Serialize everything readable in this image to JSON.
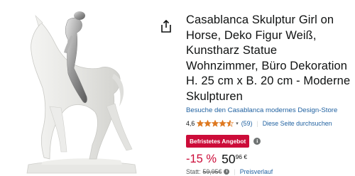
{
  "product": {
    "image_alt": "Casablanca Skulptur Girl on Horse",
    "title": "Casablanca Skulptur Girl on Horse, Deko Figur Weiß, Kunstharz Statue Wohnzimmer, Büro Dekoration H. 25 cm x B. 20 cm - Moderne Skulpturen",
    "store_link": "Besuche den Casablanca modernes Design-Store",
    "rating": {
      "value": "4,6",
      "stars_filled": 4.5,
      "stars_max": 5,
      "review_count": "(59)",
      "search_link": "Diese Seite durchsuchen"
    },
    "deal_badge": "Befristetes Angebot",
    "price": {
      "discount": "-15 %",
      "whole": "50",
      "fraction": "96 €",
      "statt_label": "Statt:",
      "old_price": "59,95€",
      "price_history": "Preisverlauf"
    }
  },
  "icons": {
    "share": "share-icon",
    "info": "info-icon",
    "caret": "chevron-down-icon"
  },
  "colors": {
    "deal_red": "#cc0c39",
    "link_blue": "#2162a1",
    "star_orange": "#de7921",
    "text": "#0f1111",
    "muted": "#565959"
  }
}
